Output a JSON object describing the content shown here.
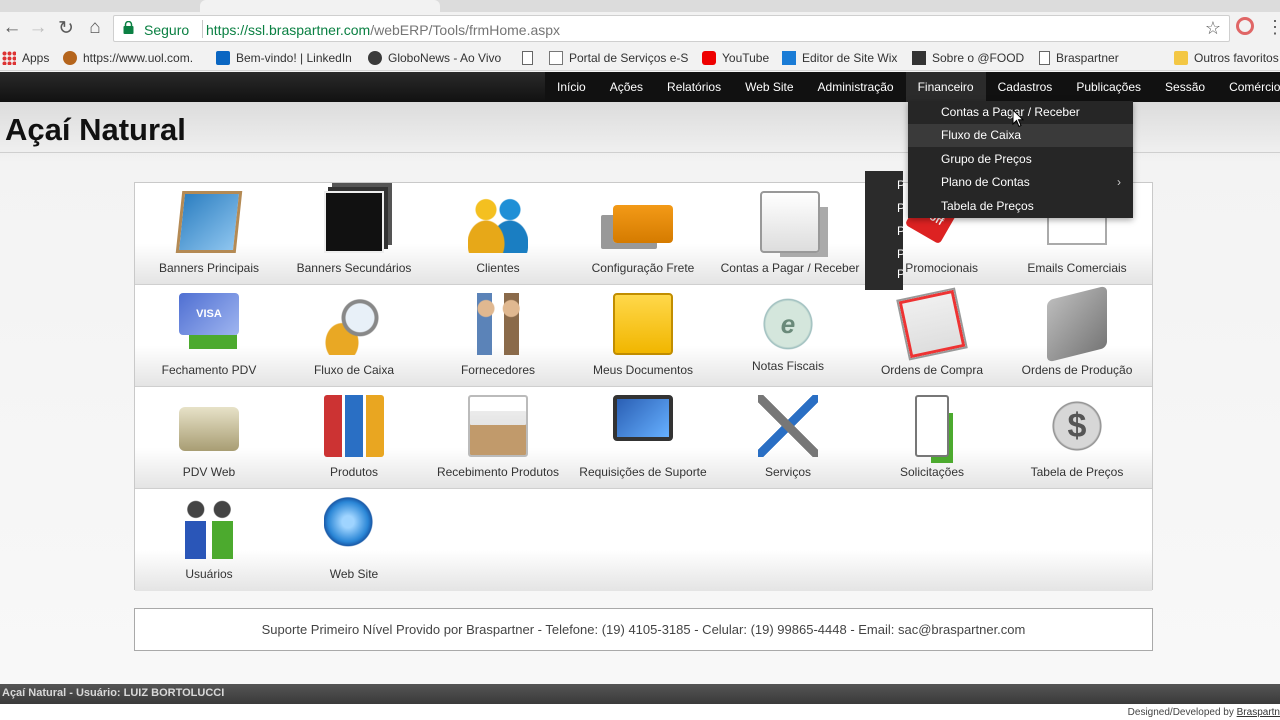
{
  "browser": {
    "secure_label": "Seguro",
    "url_host": "https://ssl.braspartner.com",
    "url_path": "/webERP/Tools/frmHome.aspx",
    "bookmarks": [
      {
        "label": "Apps",
        "icon": "apps-icon"
      },
      {
        "label": "https://www.uol.com.",
        "icon": "uol-icon"
      },
      {
        "label": "Bem-vindo! | LinkedIn",
        "icon": "linkedin-icon"
      },
      {
        "label": "GloboNews - Ao Vivo",
        "icon": "globonews-icon"
      },
      {
        "label": "",
        "icon": "page-icon"
      },
      {
        "label": "Portal de Serviços e-S",
        "icon": "portal-icon"
      },
      {
        "label": "YouTube",
        "icon": "youtube-icon"
      },
      {
        "label": "Editor de Site Wix",
        "icon": "wix-icon"
      },
      {
        "label": "Sobre o @FOOD",
        "icon": "food-icon"
      },
      {
        "label": "Braspartner",
        "icon": "page-icon"
      },
      {
        "label": "Outros favoritos",
        "icon": "folder-icon"
      }
    ]
  },
  "nav": {
    "items": [
      "Início",
      "Ações",
      "Relatórios",
      "Web Site",
      "Administração",
      "Financeiro",
      "Cadastros",
      "Publicações",
      "Sessão",
      "Comércio"
    ],
    "active": "Financeiro"
  },
  "dropdown": {
    "items": [
      "Contas a Pagar / Receber",
      "Fluxo de Caixa",
      "Grupo de Preços",
      "Plano de Contas",
      "Tabela de Preços"
    ],
    "hover": "Fluxo de Caixa",
    "submenu_item": "Plano de Contas"
  },
  "company": {
    "name": "Açaí Natural"
  },
  "tiles": [
    [
      {
        "label": "Banners Principais",
        "icon": "easel-icon"
      },
      {
        "label": "Banners Secundários",
        "icon": "photos-icon"
      },
      {
        "label": "Clientes",
        "icon": "customers-icon"
      },
      {
        "label": "Configuração Frete",
        "icon": "truck-icon"
      },
      {
        "label": "Contas a Pagar / Receber",
        "icon": "bills-icon"
      },
      {
        "label": "tos Promocionais",
        "icon": "sale-tag-icon"
      },
      {
        "label": "Emails Comerciais",
        "icon": "envelope-icon"
      }
    ],
    [
      {
        "label": "Fechamento PDV",
        "icon": "credit-card-icon"
      },
      {
        "label": "Fluxo de Caixa",
        "icon": "magnifier-coins-icon"
      },
      {
        "label": "Fornecedores",
        "icon": "suppliers-icon"
      },
      {
        "label": "Meus Documentos",
        "icon": "folder-icon"
      },
      {
        "label": "Notas Fiscais",
        "icon": "nfe-icon"
      },
      {
        "label": "Ordens de Compra",
        "icon": "purchase-order-icon"
      },
      {
        "label": "Ordens de Produção",
        "icon": "production-machine-icon"
      }
    ],
    [
      {
        "label": "PDV Web",
        "icon": "cash-register-icon"
      },
      {
        "label": "Produtos",
        "icon": "binders-icon"
      },
      {
        "label": "Recebimento Produtos",
        "icon": "package-icon"
      },
      {
        "label": "Requisições de Suporte",
        "icon": "support-monitor-icon"
      },
      {
        "label": "Serviços",
        "icon": "tools-icon"
      },
      {
        "label": "Solicitações",
        "icon": "clipboard-check-icon"
      },
      {
        "label": "Tabela de Preços",
        "icon": "dollar-icon"
      }
    ],
    [
      {
        "label": "Usuários",
        "icon": "users-icon"
      },
      {
        "label": "Web Site",
        "icon": "globe-icon"
      }
    ]
  ],
  "side_popup": {
    "letters": [
      "P",
      "P",
      "P",
      "P",
      "P"
    ]
  },
  "support": {
    "text": "Suporte Primeiro Nível Provido por Braspartner - Telefone: (19) 4105-3185 - Celular: (19) 99865-4448 - Email: sac@braspartner.com"
  },
  "status_bar": {
    "text": "Açaí Natural - Usuário: LUIZ BORTOLUCCI"
  },
  "credit": {
    "prefix": "Designed/Developed by ",
    "link": "Braspartn"
  }
}
